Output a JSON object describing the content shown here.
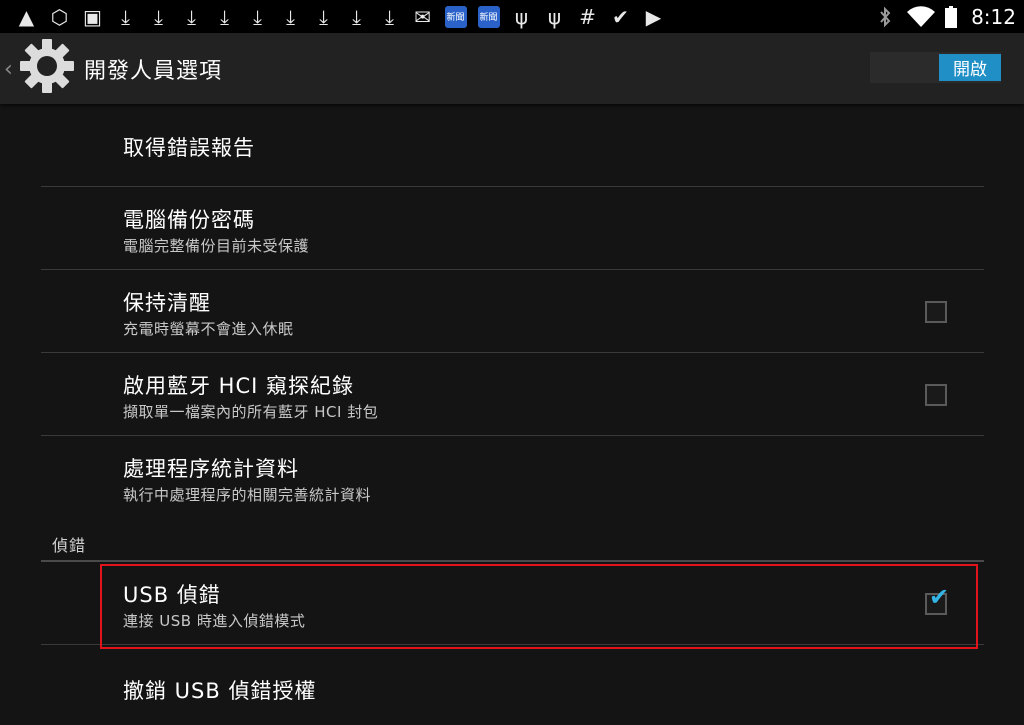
{
  "status_bar": {
    "time": "8:12",
    "left_icons": [
      {
        "icon": "warning-icon",
        "glyph": "▲"
      },
      {
        "icon": "clock-badge-icon",
        "glyph": "⬡"
      },
      {
        "icon": "image-icon",
        "glyph": "▣"
      },
      {
        "icon": "download-icon",
        "glyph": "⤓"
      },
      {
        "icon": "download-icon",
        "glyph": "⤓"
      },
      {
        "icon": "download-icon",
        "glyph": "⤓"
      },
      {
        "icon": "download-icon",
        "glyph": "⤓"
      },
      {
        "icon": "download-icon",
        "glyph": "⤓"
      },
      {
        "icon": "download-icon",
        "glyph": "⤓"
      },
      {
        "icon": "download-icon",
        "glyph": "⤓"
      },
      {
        "icon": "download-icon",
        "glyph": "⤓"
      },
      {
        "icon": "download-icon",
        "glyph": "⤓"
      },
      {
        "icon": "mail-icon",
        "glyph": "✉"
      },
      {
        "icon": "news-app-icon",
        "glyph": "新聞"
      },
      {
        "icon": "news-app-icon",
        "glyph": "新聞"
      },
      {
        "icon": "usb-icon",
        "glyph": "ψ"
      },
      {
        "icon": "usb-icon",
        "glyph": "ψ"
      },
      {
        "icon": "hash-icon",
        "glyph": "#"
      },
      {
        "icon": "store-bag-icon",
        "glyph": "✔"
      },
      {
        "icon": "play-store-icon",
        "glyph": "▶"
      }
    ],
    "right_icons": {
      "bluetooth": "bluetooth-icon",
      "wifi": "wifi-icon",
      "battery": "battery-icon"
    }
  },
  "action_bar": {
    "title": "開發人員選項",
    "switch_label": "開啟",
    "accent": "#1f8fc6"
  },
  "settings": {
    "bug_report": {
      "title": "取得錯誤報告"
    },
    "backup_password": {
      "title": "電腦備份密碼",
      "summary": "電腦完整備份目前未受保護"
    },
    "stay_awake": {
      "title": "保持清醒",
      "summary": "充電時螢幕不會進入休眠",
      "checked": false
    },
    "bt_hci": {
      "title": "啟用藍牙 HCI 窺探紀錄",
      "summary": "擷取單一檔案內的所有藍牙 HCI 封包",
      "checked": false
    },
    "process_stats": {
      "title": "處理程序統計資料",
      "summary": "執行中處理程序的相關完善統計資料"
    }
  },
  "debug_section": {
    "header": "偵錯",
    "usb_debugging": {
      "title": "USB 偵錯",
      "summary": "連接 USB 時進入偵錯模式",
      "checked": true
    },
    "revoke_usb": {
      "title": "撤銷 USB 偵錯授權"
    }
  },
  "colors": {
    "checkmark": "#33b5e5",
    "highlight": "#e0141a"
  }
}
